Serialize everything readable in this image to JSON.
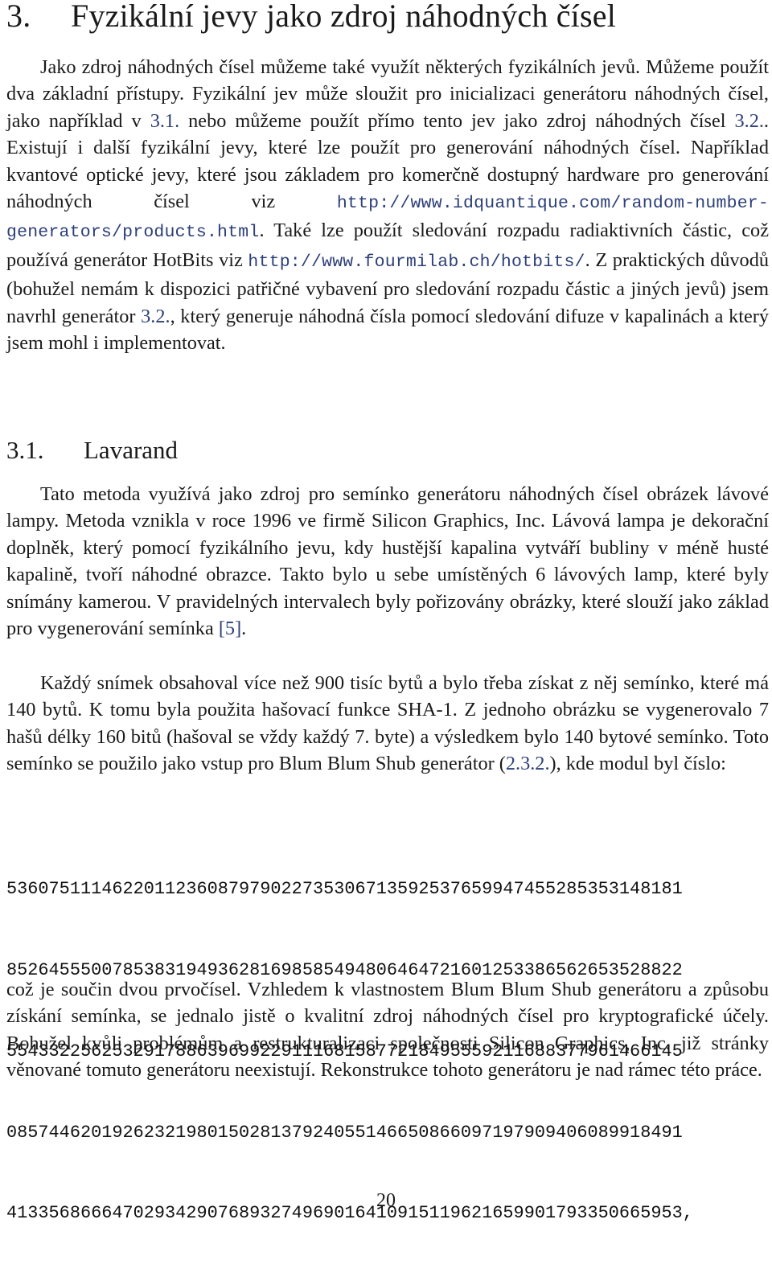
{
  "section": {
    "number": "3.",
    "title": "Fyzikální jevy jako zdroj náhodných čísel"
  },
  "intro": {
    "t1": "Jako zdroj náhodných čísel můžeme také využít některých fyzikálních jevů. Můžeme použít dva základní přístupy. Fyzikální jev může sloužit pro inicializaci generátoru náhodných čísel, jako například v ",
    "ref1": "3.1.",
    "t2": " nebo můžeme použít přímo tento jev jako zdroj náhodných čísel ",
    "ref2": "3.2.",
    "t3": ". Existují i další fyzikální jevy, které lze použít pro generování náhodných čísel. Například kvantové optické jevy, které jsou základem pro komerčně dostupný hardware pro generování náhodných čísel viz ",
    "url1": "http://www.idquantique.com/random-number-generators/products.html",
    "t4": ". Také lze použít sledování rozpadu radiaktivních částic, což používá generátor HotBits viz ",
    "url2": "http://www.fourmilab.ch/hotbits/",
    "t5": ". Z praktických důvodů (bohužel nemám k dispozici patřičné vybavení pro sledování rozpadu částic a jiných jevů) jsem navrhl generátor ",
    "ref3": "3.2.",
    "t6": ", který generuje náhodná čísla pomocí sledování difuze v kapalinách a který jsem mohl i implementovat."
  },
  "subsection": {
    "number": "3.1.",
    "title": "Lavarand"
  },
  "lavarand": {
    "p1_text": "Tato metoda využívá jako zdroj pro semínko generátoru náhodných čísel obrázek lávové lampy. Metoda vznikla v roce 1996 ve firmě Silicon Graphics, Inc. Lávová lampa je dekorační doplněk, který pomocí fyzikálního jevu, kdy hustější kapalina vytváří bubliny v méně husté kapalině, tvoří náhodné obrazce. Takto bylo u sebe umístěných 6 lávových lamp, které byly snímány kamerou. V pravidelných intervalech byly pořizovány obrázky, které slouží jako základ pro vygenerování semínka ",
    "p1_cite": "[5]",
    "p1_end": ".",
    "p2_text": "Každý snímek obsahoval více než 900 tisíc bytů a bylo třeba získat z něj semínko, které má 140 bytů. K tomu byla použita hašovací funkce SHA-1. Z jednoho obrázku se vygenerovalo 7 hašů délky 160 bitů (hašoval se vždy každý 7. byte) a výsledkem bylo 140 bytové semínko. Toto semínko se použilo jako vstup pro Blum Blum Shub generátor (",
    "p2_ref": "2.3.2.",
    "p2_end": "), kde modul byl číslo:",
    "modulus_lines": [
      "5360751114622011236087979022735306713592537659947455285353148181",
      "8526455500785383194936281698585494806464721601253386562653528822",
      "5543322562532917886396992291116815877218495559211688377961466145",
      "0857446201926232198015028137924055146650866097197909406089918491",
      "4133568666470293429076893274969016410915119621659901793350665953,"
    ],
    "p3_text": "což je součin dvou prvočísel. Vzhledem k vlastnostem Blum Blum Shub generátoru a způsobu získání semínka, se jednalo jistě o kvalitní zdroj náhodných čísel pro kryptografické účely. Bohužel kvůli problémům a restrukturalizaci společnosti Silicon Graphics, Inc. již stránky věnované tomuto generátoru neexistují. Rekonstrukce tohoto generátoru je nad rámec této práce."
  },
  "page_number": "20",
  "colors": {
    "text": "#1a1a1a",
    "link": "#2c3f78"
  }
}
